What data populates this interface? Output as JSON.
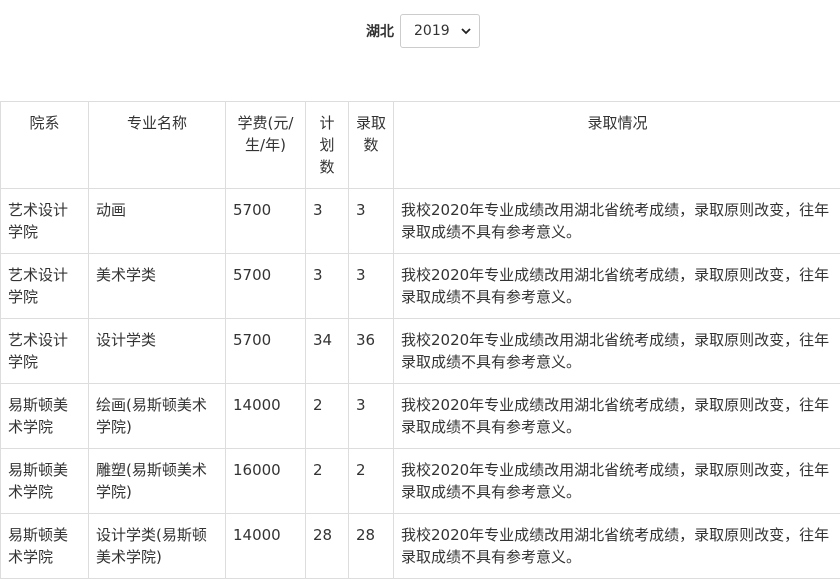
{
  "filter": {
    "province": "湖北",
    "year": "2019"
  },
  "table": {
    "headers": {
      "dept": "院系",
      "major": "专业名称",
      "fee": "学费(元/生/年)",
      "plan": "计划数",
      "admitted": "录取数",
      "notes": "录取情况"
    },
    "rows": [
      {
        "dept": "艺术设计学院",
        "major": "动画",
        "fee": "5700",
        "plan": "3",
        "admitted": "3",
        "notes": "我校2020年专业成绩改用湖北省统考成绩，录取原则改变，往年录取成绩不具有参考意义。"
      },
      {
        "dept": "艺术设计学院",
        "major": "美术学类",
        "fee": "5700",
        "plan": "3",
        "admitted": "3",
        "notes": "我校2020年专业成绩改用湖北省统考成绩，录取原则改变，往年录取成绩不具有参考意义。"
      },
      {
        "dept": "艺术设计学院",
        "major": "设计学类",
        "fee": "5700",
        "plan": "34",
        "admitted": "36",
        "notes": "我校2020年专业成绩改用湖北省统考成绩，录取原则改变，往年录取成绩不具有参考意义。"
      },
      {
        "dept": "易斯顿美术学院",
        "major": "绘画(易斯顿美术学院)",
        "fee": "14000",
        "plan": "2",
        "admitted": "3",
        "notes": "我校2020年专业成绩改用湖北省统考成绩，录取原则改变，往年录取成绩不具有参考意义。"
      },
      {
        "dept": "易斯顿美术学院",
        "major": "雕塑(易斯顿美术学院)",
        "fee": "16000",
        "plan": "2",
        "admitted": "2",
        "notes": "我校2020年专业成绩改用湖北省统考成绩，录取原则改变，往年录取成绩不具有参考意义。"
      },
      {
        "dept": "易斯顿美术学院",
        "major": "设计学类(易斯顿美术学院)",
        "fee": "14000",
        "plan": "28",
        "admitted": "28",
        "notes": "我校2020年专业成绩改用湖北省统考成绩，录取原则改变，往年录取成绩不具有参考意义。"
      }
    ]
  }
}
